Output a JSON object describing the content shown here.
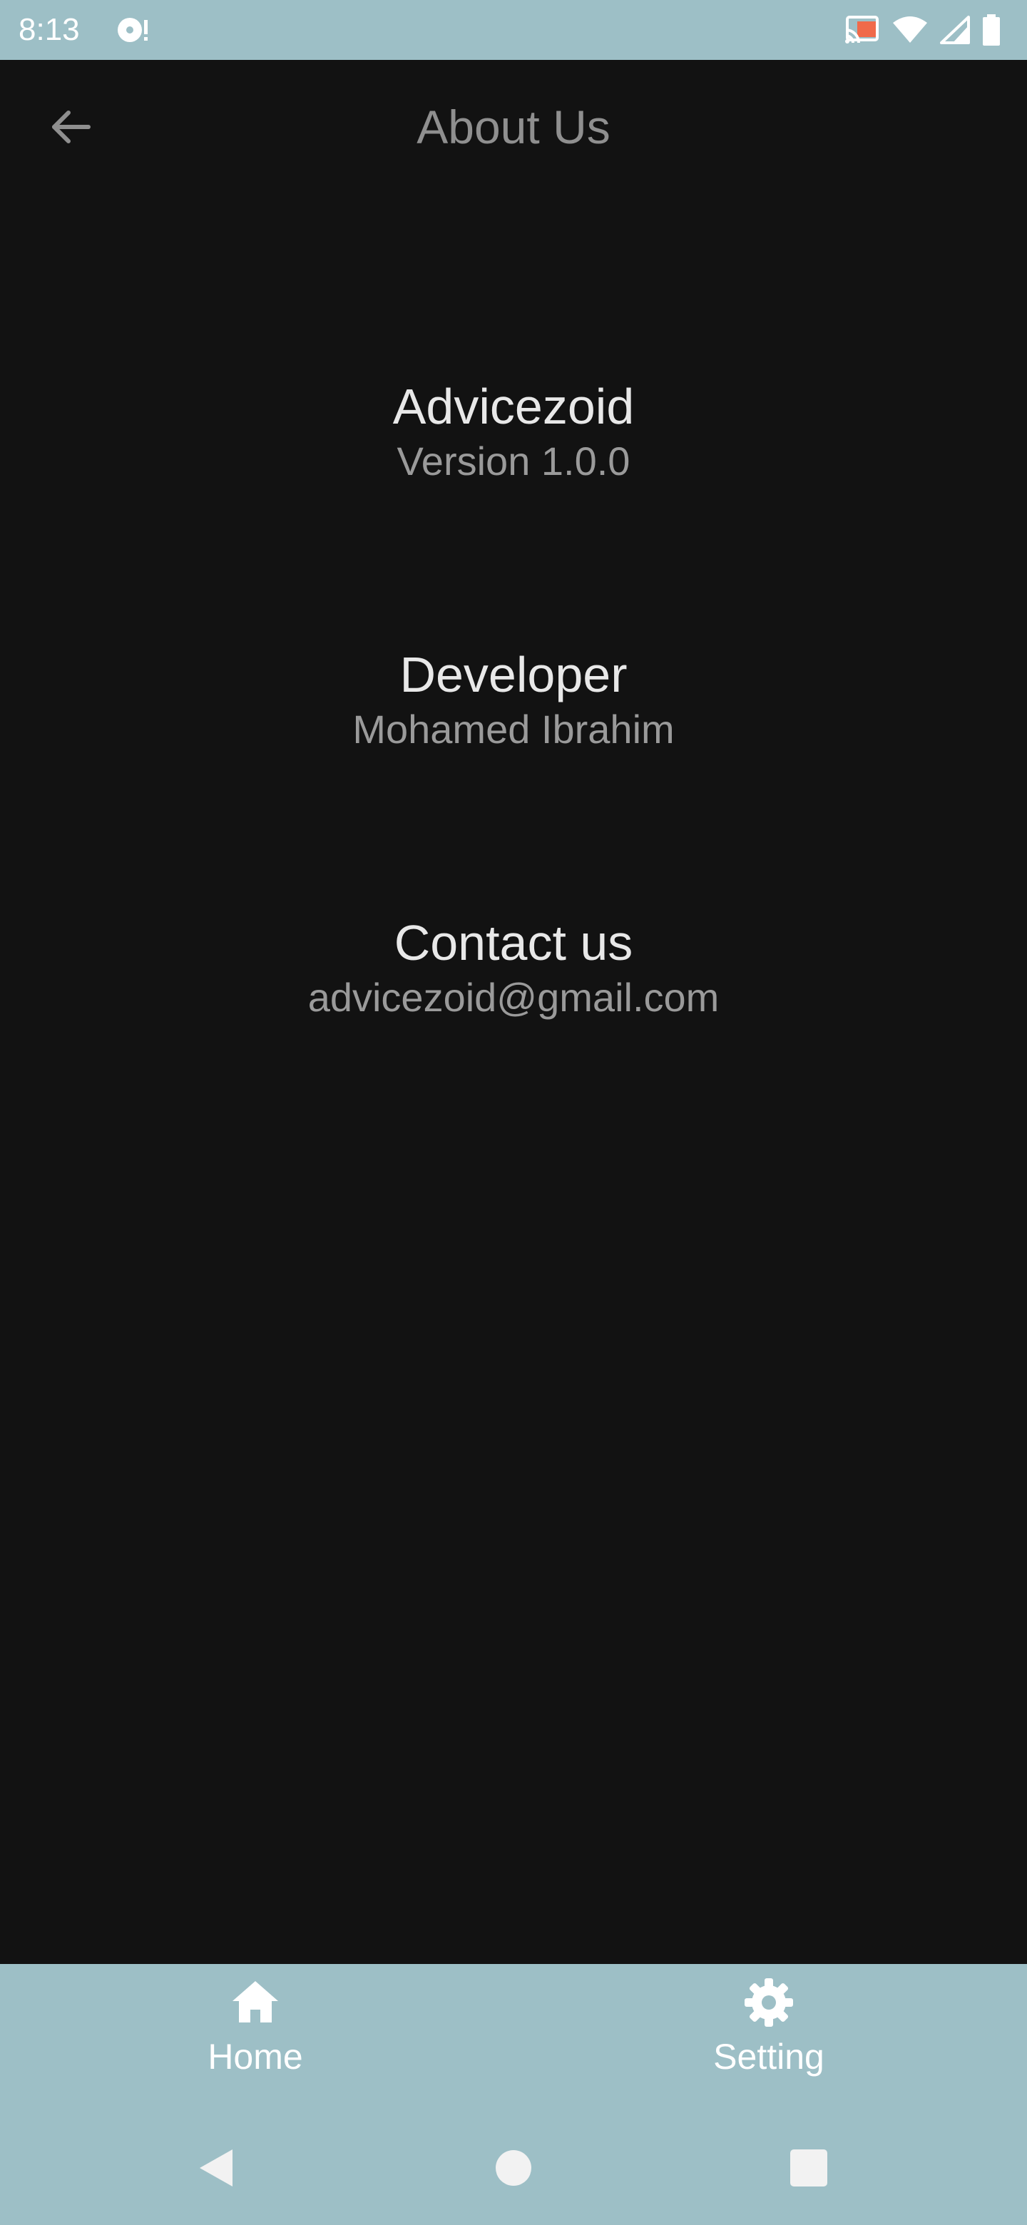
{
  "status_bar": {
    "time": "8:13",
    "left_icons": [
      "media-notification-icon"
    ],
    "right_icons": [
      "cast-icon",
      "wifi-icon",
      "signal-icon",
      "battery-icon"
    ]
  },
  "app_bar": {
    "title": "About Us",
    "back_icon": "arrow-left-icon"
  },
  "sections": {
    "app": {
      "heading": "Advicezoid",
      "value": "Version 1.0.0"
    },
    "developer": {
      "heading": "Developer",
      "value": "Mohamed Ibrahim"
    },
    "contact": {
      "heading": "Contact us",
      "value": "advicezoid@gmail.com"
    }
  },
  "bottom_nav": {
    "items": [
      {
        "label": "Home",
        "icon": "home-icon"
      },
      {
        "label": "Setting",
        "icon": "gear-icon"
      }
    ]
  },
  "system_nav": {
    "buttons": [
      "back-triangle-icon",
      "home-circle-icon",
      "recents-square-icon"
    ]
  },
  "colors": {
    "background": "#121212",
    "accent_bar": "#9dbfc6",
    "heading": "#e8e8e8",
    "subtext": "#9a9a9a",
    "title": "#8f8f8f"
  }
}
